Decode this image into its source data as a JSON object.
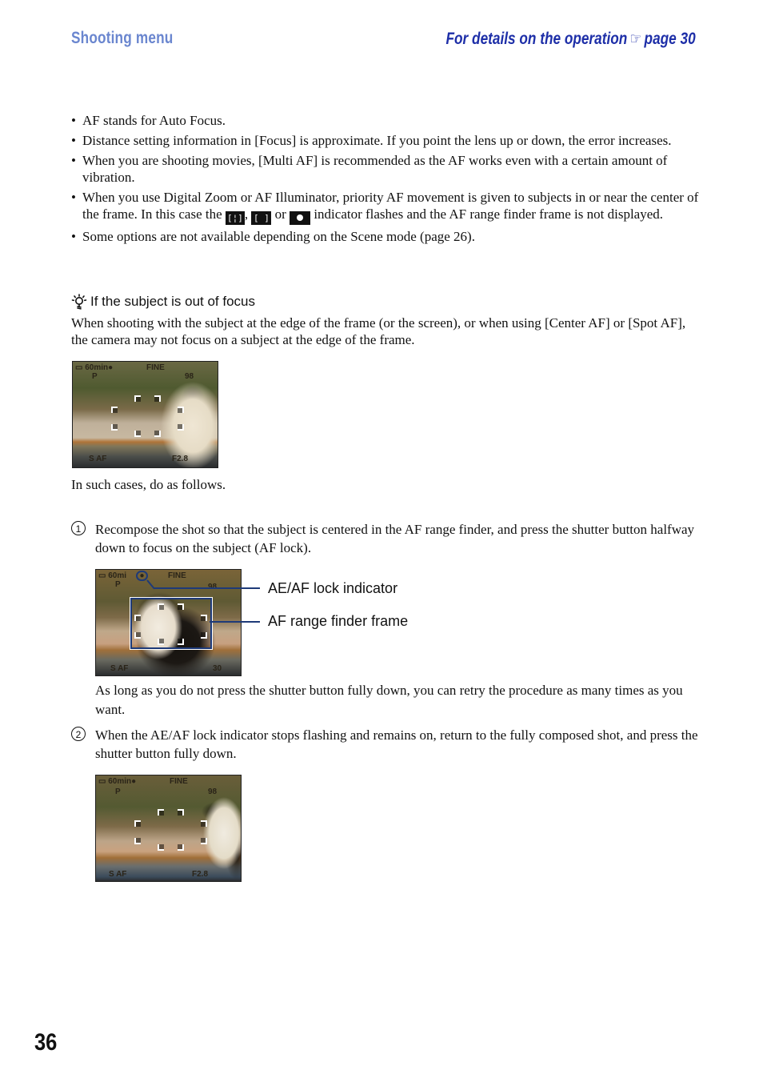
{
  "header": {
    "section_title": "Shooting menu",
    "reference_prefix": "For details on the operation",
    "reference_icon": "pointing-hand-icon",
    "reference_page": "page 30"
  },
  "notes": [
    {
      "text": "AF stands for Auto Focus."
    },
    {
      "text": "Distance setting information in [Focus] is approximate. If you point the lens up or down, the error increases."
    },
    {
      "text": "When you are shooting movies, [Multi AF] is recommended as the AF works even with a certain amount of vibration."
    },
    {
      "text_before": "When you use Digital Zoom or AF Illuminator, priority AF movement is given to subjects in or near the center of the frame. In this case the",
      "indicators": [
        "multi-af-indicator",
        "center-af-indicator",
        "spot-af-indicator"
      ],
      "sep1": ",",
      "sep2": "or",
      "text_after": "indicator flashes and the AF range finder frame is not displayed."
    },
    {
      "text": "Some options are not available depending on the Scene mode (page 26)."
    }
  ],
  "tip": {
    "icon": "lightbulb-hint-icon",
    "title": "If the subject is out of focus",
    "body": "When shooting with the subject at the edge of the frame (or the screen), or when using [Center AF] or [Spot AF], the camera may not focus on a subject at the edge of the frame.",
    "after_image": "In such cases, do as follows."
  },
  "screens": {
    "screen1": {
      "battery": "60min",
      "quality": "FINE",
      "mode": "P",
      "count": "98",
      "af": "S AF",
      "bottom_right": "F2.8"
    },
    "screen2": {
      "battery": "60mi",
      "quality": "FINE",
      "mode": "P",
      "count": "98",
      "af": "S AF",
      "bottom_right": "30"
    },
    "screen3": {
      "battery": "60min",
      "quality": "FINE",
      "mode": "P",
      "count": "98",
      "af": "S AF",
      "bottom_right": "F2.8"
    }
  },
  "steps": [
    {
      "number": "1",
      "text": "Recompose the shot so that the subject is centered in the AF range finder, and press the shutter button halfway down to focus on the subject (AF lock).",
      "note": "As long as you do not press the shutter button fully down, you can retry the procedure as many times as you want."
    },
    {
      "number": "2",
      "text": "When the AE/AF lock indicator stops flashing and remains on, return to the fully composed shot, and press the shutter button fully down."
    }
  ],
  "callouts": {
    "ae_af_lock": "AE/AF lock indicator",
    "af_range_finder": "AF range finder frame"
  },
  "colors": {
    "section_title": "#6a86cf",
    "reference_link": "#1e2fa8",
    "callout_line": "#1e3a78"
  },
  "page_number": "36"
}
